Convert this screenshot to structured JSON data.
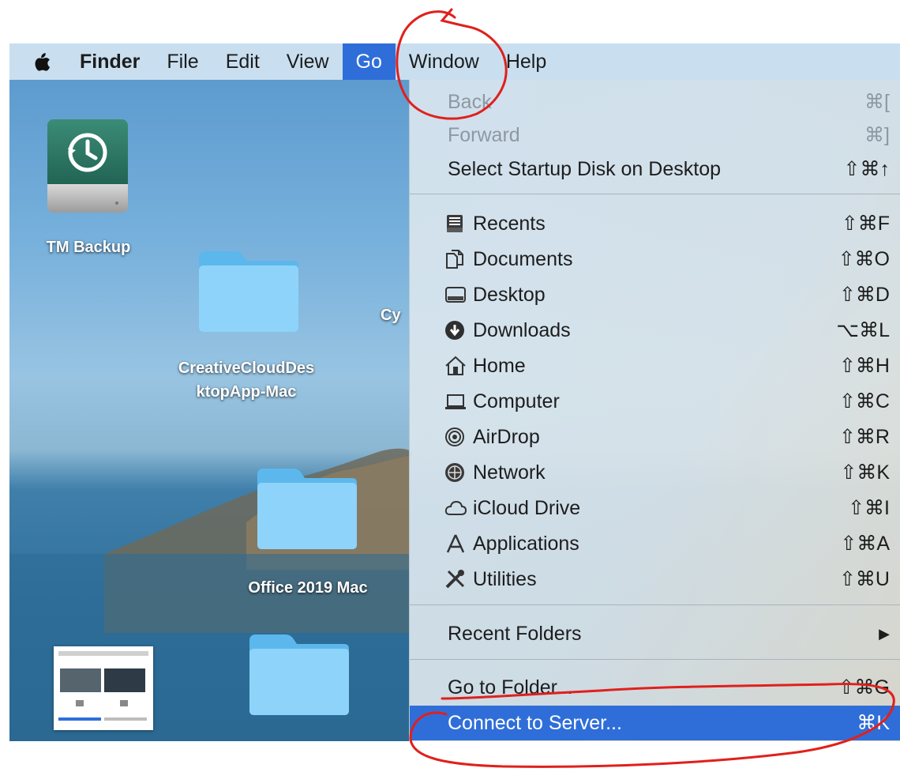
{
  "menubar": {
    "apple": "apple-logo",
    "items": [
      "Finder",
      "File",
      "Edit",
      "View",
      "Go",
      "Window",
      "Help"
    ]
  },
  "desktop": {
    "icons": [
      {
        "label": "TM Backup"
      },
      {
        "label_line1": "CreativeCloudDes",
        "label_line2": "ktopApp-Mac"
      },
      {
        "label": "Cy"
      },
      {
        "label": "Office 2019 Mac"
      }
    ]
  },
  "go_menu": {
    "items": [
      {
        "label": "Back",
        "shortcut": "⌘[",
        "enabled": false
      },
      {
        "label": "Forward",
        "shortcut": "⌘]",
        "enabled": false
      },
      {
        "label": "Select Startup Disk on Desktop",
        "shortcut": "⇧⌘↑",
        "enabled": true
      },
      {
        "label": "Recents",
        "shortcut": "⇧⌘F",
        "icon": "recents-icon"
      },
      {
        "label": "Documents",
        "shortcut": "⇧⌘O",
        "icon": "documents-icon"
      },
      {
        "label": "Desktop",
        "shortcut": "⇧⌘D",
        "icon": "desktop-icon"
      },
      {
        "label": "Downloads",
        "shortcut": "⌥⌘L",
        "icon": "downloads-icon"
      },
      {
        "label": "Home",
        "shortcut": "⇧⌘H",
        "icon": "home-icon"
      },
      {
        "label": "Computer",
        "shortcut": "⇧⌘C",
        "icon": "computer-icon"
      },
      {
        "label": "AirDrop",
        "shortcut": "⇧⌘R",
        "icon": "airdrop-icon"
      },
      {
        "label": "Network",
        "shortcut": "⇧⌘K",
        "icon": "network-icon"
      },
      {
        "label": "iCloud Drive",
        "shortcut": "⇧⌘I",
        "icon": "icloud-icon"
      },
      {
        "label": "Applications",
        "shortcut": "⇧⌘A",
        "icon": "applications-icon"
      },
      {
        "label": "Utilities",
        "shortcut": "⇧⌘U",
        "icon": "utilities-icon"
      },
      {
        "label": "Recent Folders",
        "shortcut": "▶"
      },
      {
        "label": "Go to Folder...",
        "shortcut": "⇧⌘G"
      },
      {
        "label": "Connect to Server...",
        "shortcut": "⌘K",
        "selected": true
      }
    ]
  },
  "colors": {
    "menubar": "#c9dff0",
    "highlight": "#2f6ed9",
    "annotation": "#e0201c"
  }
}
